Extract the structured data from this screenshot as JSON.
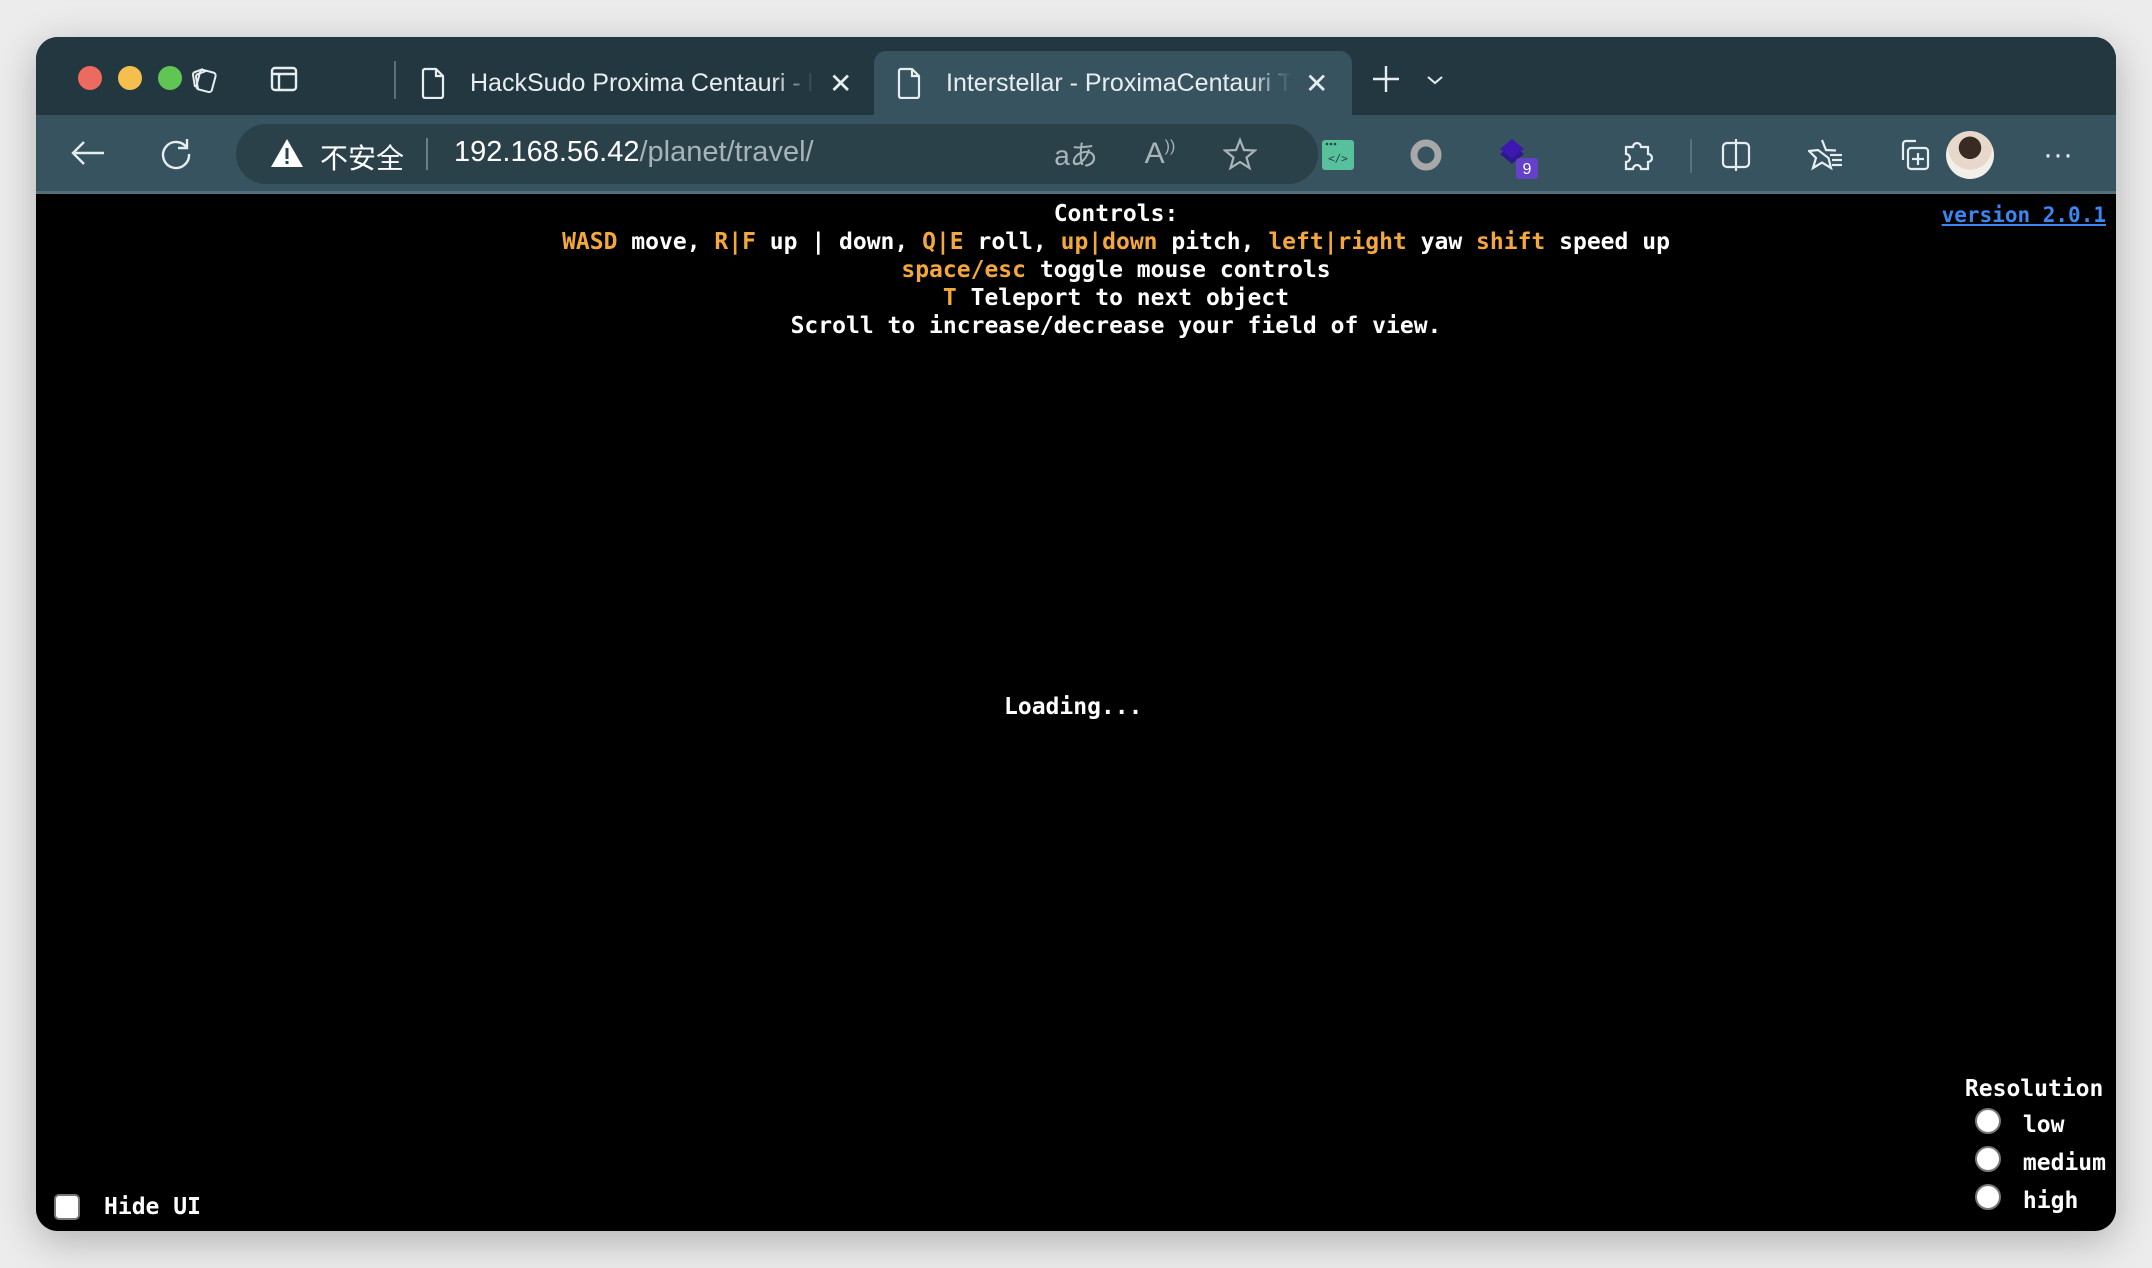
{
  "browser": {
    "tabs": [
      {
        "title": "HackSudo Proxima Centauri - l",
        "active": false
      },
      {
        "title": "Interstellar - ProximaCentauri T",
        "active": true
      }
    ],
    "address": {
      "security_label": "不安全",
      "url_host": "192.168.56.42",
      "url_path": "/planet/travel/"
    },
    "extensions_badge": "9",
    "colors": {
      "tabbar": "#233740",
      "toolbar": "#37535f",
      "accent_orange": "#f4a73a",
      "link_blue": "#3b86f0"
    }
  },
  "page": {
    "controls_title": "Controls:",
    "line1": [
      {
        "t": "WASD",
        "hl": true
      },
      {
        "t": " move, ",
        "hl": false
      },
      {
        "t": "R|F",
        "hl": true
      },
      {
        "t": " up | down, ",
        "hl": false
      },
      {
        "t": "Q|E",
        "hl": true
      },
      {
        "t": " roll, ",
        "hl": false
      },
      {
        "t": "up|down",
        "hl": true
      },
      {
        "t": " pitch, ",
        "hl": false
      },
      {
        "t": "left|right",
        "hl": true
      },
      {
        "t": " yaw ",
        "hl": false
      },
      {
        "t": "shift",
        "hl": true
      },
      {
        "t": " speed up",
        "hl": false
      }
    ],
    "line2_key": "space/esc",
    "line2_text": " toggle mouse controls",
    "line3_key": "T",
    "line3_text": " Teleport to next object",
    "line4": "Scroll to increase/decrease your field of view.",
    "version_link": "version 2.0.1",
    "loading": "Loading...",
    "hide_ui_label": "Hide UI",
    "resolution": {
      "title": "Resolution",
      "options": [
        "low",
        "medium",
        "high"
      ]
    }
  }
}
